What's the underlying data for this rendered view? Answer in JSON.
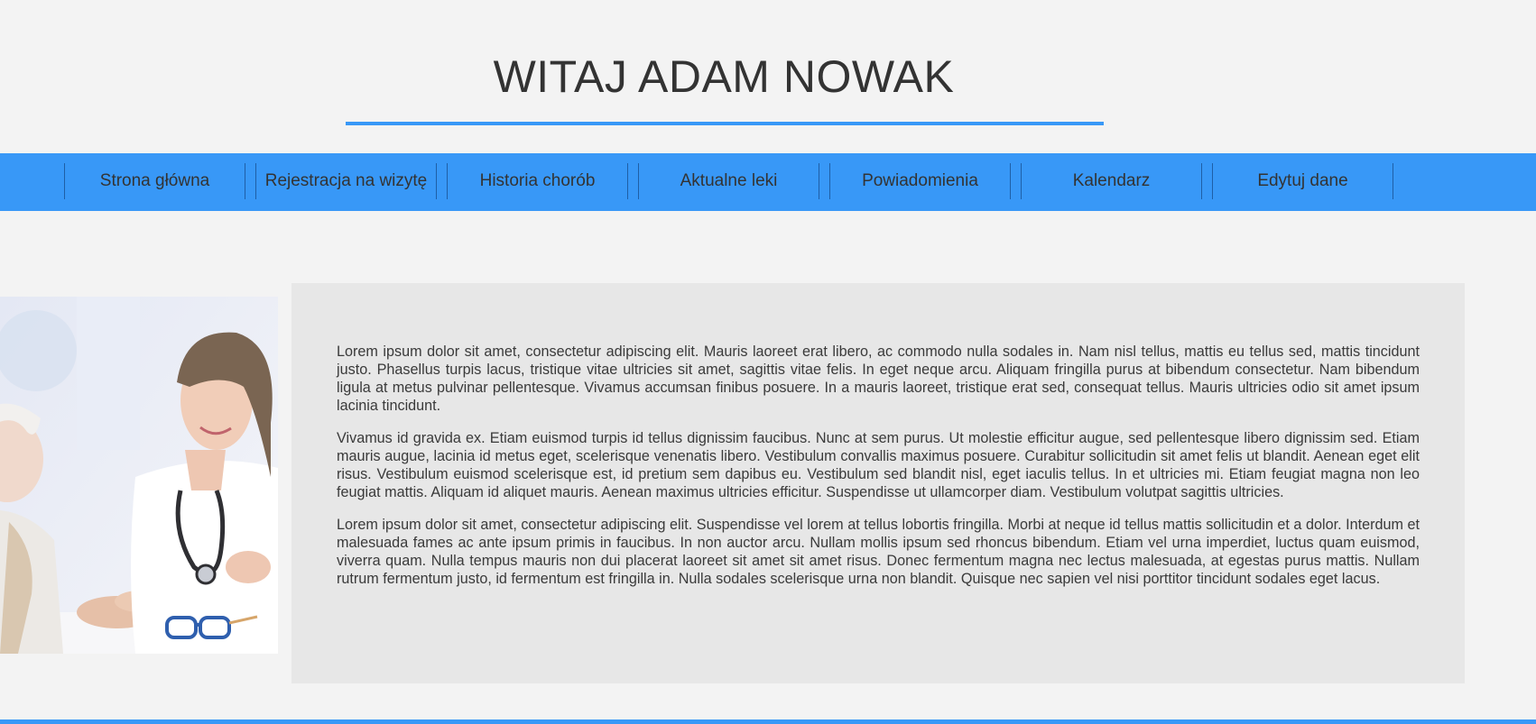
{
  "header": {
    "title": "WITAJ ADAM NOWAK"
  },
  "nav": {
    "items": [
      {
        "label": "Strona główna"
      },
      {
        "label": "Rejestracja na wizytę"
      },
      {
        "label": "Historia chorób"
      },
      {
        "label": "Aktualne leki"
      },
      {
        "label": "Powiadomienia"
      },
      {
        "label": "Kalendarz"
      },
      {
        "label": "Edytuj dane"
      }
    ]
  },
  "content": {
    "paragraphs": [
      "Lorem ipsum dolor sit amet, consectetur adipiscing elit. Mauris laoreet erat libero, ac commodo nulla sodales in. Nam nisl tellus, mattis eu tellus sed, mattis tincidunt justo. Phasellus turpis lacus, tristique vitae ultricies sit amet, sagittis vitae felis. In eget neque arcu. Aliquam fringilla purus at bibendum consectetur. Nam bibendum ligula at metus pulvinar pellentesque. Vivamus accumsan finibus posuere. In a mauris laoreet, tristique erat sed, consequat tellus. Mauris ultricies odio sit amet ipsum lacinia tincidunt.",
      "Vivamus id gravida ex. Etiam euismod turpis id tellus dignissim faucibus. Nunc at sem purus. Ut molestie efficitur augue, sed pellentesque libero dignissim sed. Etiam mauris augue, lacinia id metus eget, scelerisque venenatis libero. Vestibulum convallis maximus posuere. Curabitur sollicitudin sit amet felis ut blandit. Aenean eget elit risus. Vestibulum euismod scelerisque est, id pretium sem dapibus eu. Vestibulum sed blandit nisl, eget iaculis tellus. In et ultricies mi. Etiam feugiat magna non leo feugiat mattis. Aliquam id aliquet mauris. Aenean maximus ultricies efficitur. Suspendisse ut ullamcorper diam. Vestibulum volutpat sagittis ultricies.",
      "Lorem ipsum dolor sit amet, consectetur adipiscing elit. Suspendisse vel lorem at tellus lobortis fringilla. Morbi at neque id tellus mattis sollicitudin et a dolor. Interdum et malesuada fames ac ante ipsum primis in faucibus. In non auctor arcu. Nullam mollis ipsum sed rhoncus bibendum. Etiam vel urna imperdiet, luctus quam euismod, viverra quam. Nulla tempus mauris non dui placerat laoreet sit amet sit amet risus. Donec fermentum magna nec lectus malesuada, at egestas purus mattis. Nullam rutrum fermentum justo, id fermentum est fringilla in. Nulla sodales scelerisque urna non blandit. Quisque nec sapien vel nisi porttitor tincidunt sodales eget lacus."
    ]
  },
  "colors": {
    "accent": "#3898f7",
    "background": "#f3f3f3",
    "content_box": "#e7e7e7",
    "text": "#3a3a3a"
  }
}
